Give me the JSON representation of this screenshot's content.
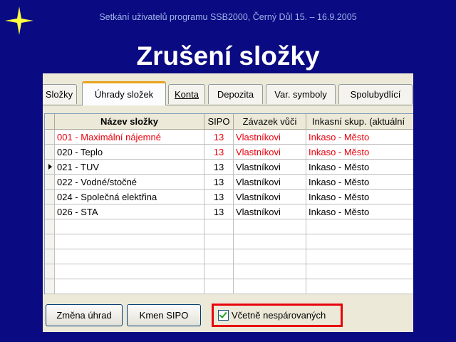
{
  "header": {
    "subtitle": "Setkání uživatelů programu SSB2000, Černý Důl 15. – 16.9.2005",
    "title": "Zrušení složky"
  },
  "tabs": [
    {
      "label": "Složky",
      "active": false
    },
    {
      "label": "Úhrady složek",
      "active": true
    },
    {
      "label": "Konta",
      "active": false
    },
    {
      "label": "Depozita",
      "active": false
    },
    {
      "label": "Var. symboly",
      "active": false
    },
    {
      "label": "Spolubydlící",
      "active": false
    }
  ],
  "table": {
    "columns": [
      "Název složky",
      "SIPO",
      "Závazek vůči",
      "Inkasní skup. (aktuální"
    ],
    "rows": [
      {
        "name": "001 - Maximální nájemné",
        "sipo": "13",
        "zavazek": "Vlastníkovi",
        "inkaso": "Inkaso - Město",
        "color": "#e8000c",
        "current": false
      },
      {
        "name": "020 - Teplo",
        "sipo": "13",
        "zavazek": "Vlastníkovi",
        "inkaso": "Inkaso - Město",
        "color": "mixed",
        "current": false
      },
      {
        "name": "021 - TUV",
        "sipo": "13",
        "zavazek": "Vlastníkovi",
        "inkaso": "Inkaso - Město",
        "color": "#000000",
        "current": true
      },
      {
        "name": "022 - Vodné/stočné",
        "sipo": "13",
        "zavazek": "Vlastníkovi",
        "inkaso": "Inkaso - Město",
        "color": "#000000",
        "current": false
      },
      {
        "name": "024 - Společná elektřina",
        "sipo": "13",
        "zavazek": "Vlastníkovi",
        "inkaso": "Inkaso - Město",
        "color": "#000000",
        "current": false
      },
      {
        "name": "026 - STA",
        "sipo": "13",
        "zavazek": "Vlastníkovi",
        "inkaso": "Inkaso - Město",
        "color": "#000000",
        "current": false
      }
    ]
  },
  "buttons": {
    "zmena_uhrad": "Změna úhrad",
    "kmen_sipo": "Kmen SIPO"
  },
  "checkbox": {
    "label": "Včetně nespárovaných",
    "checked": true
  },
  "colors": {
    "background": "#0a0a82",
    "highlight": "#e8000c",
    "active_tab_accent": "#e8a21a"
  },
  "icons": {
    "logo": "four-point-star-icon"
  }
}
